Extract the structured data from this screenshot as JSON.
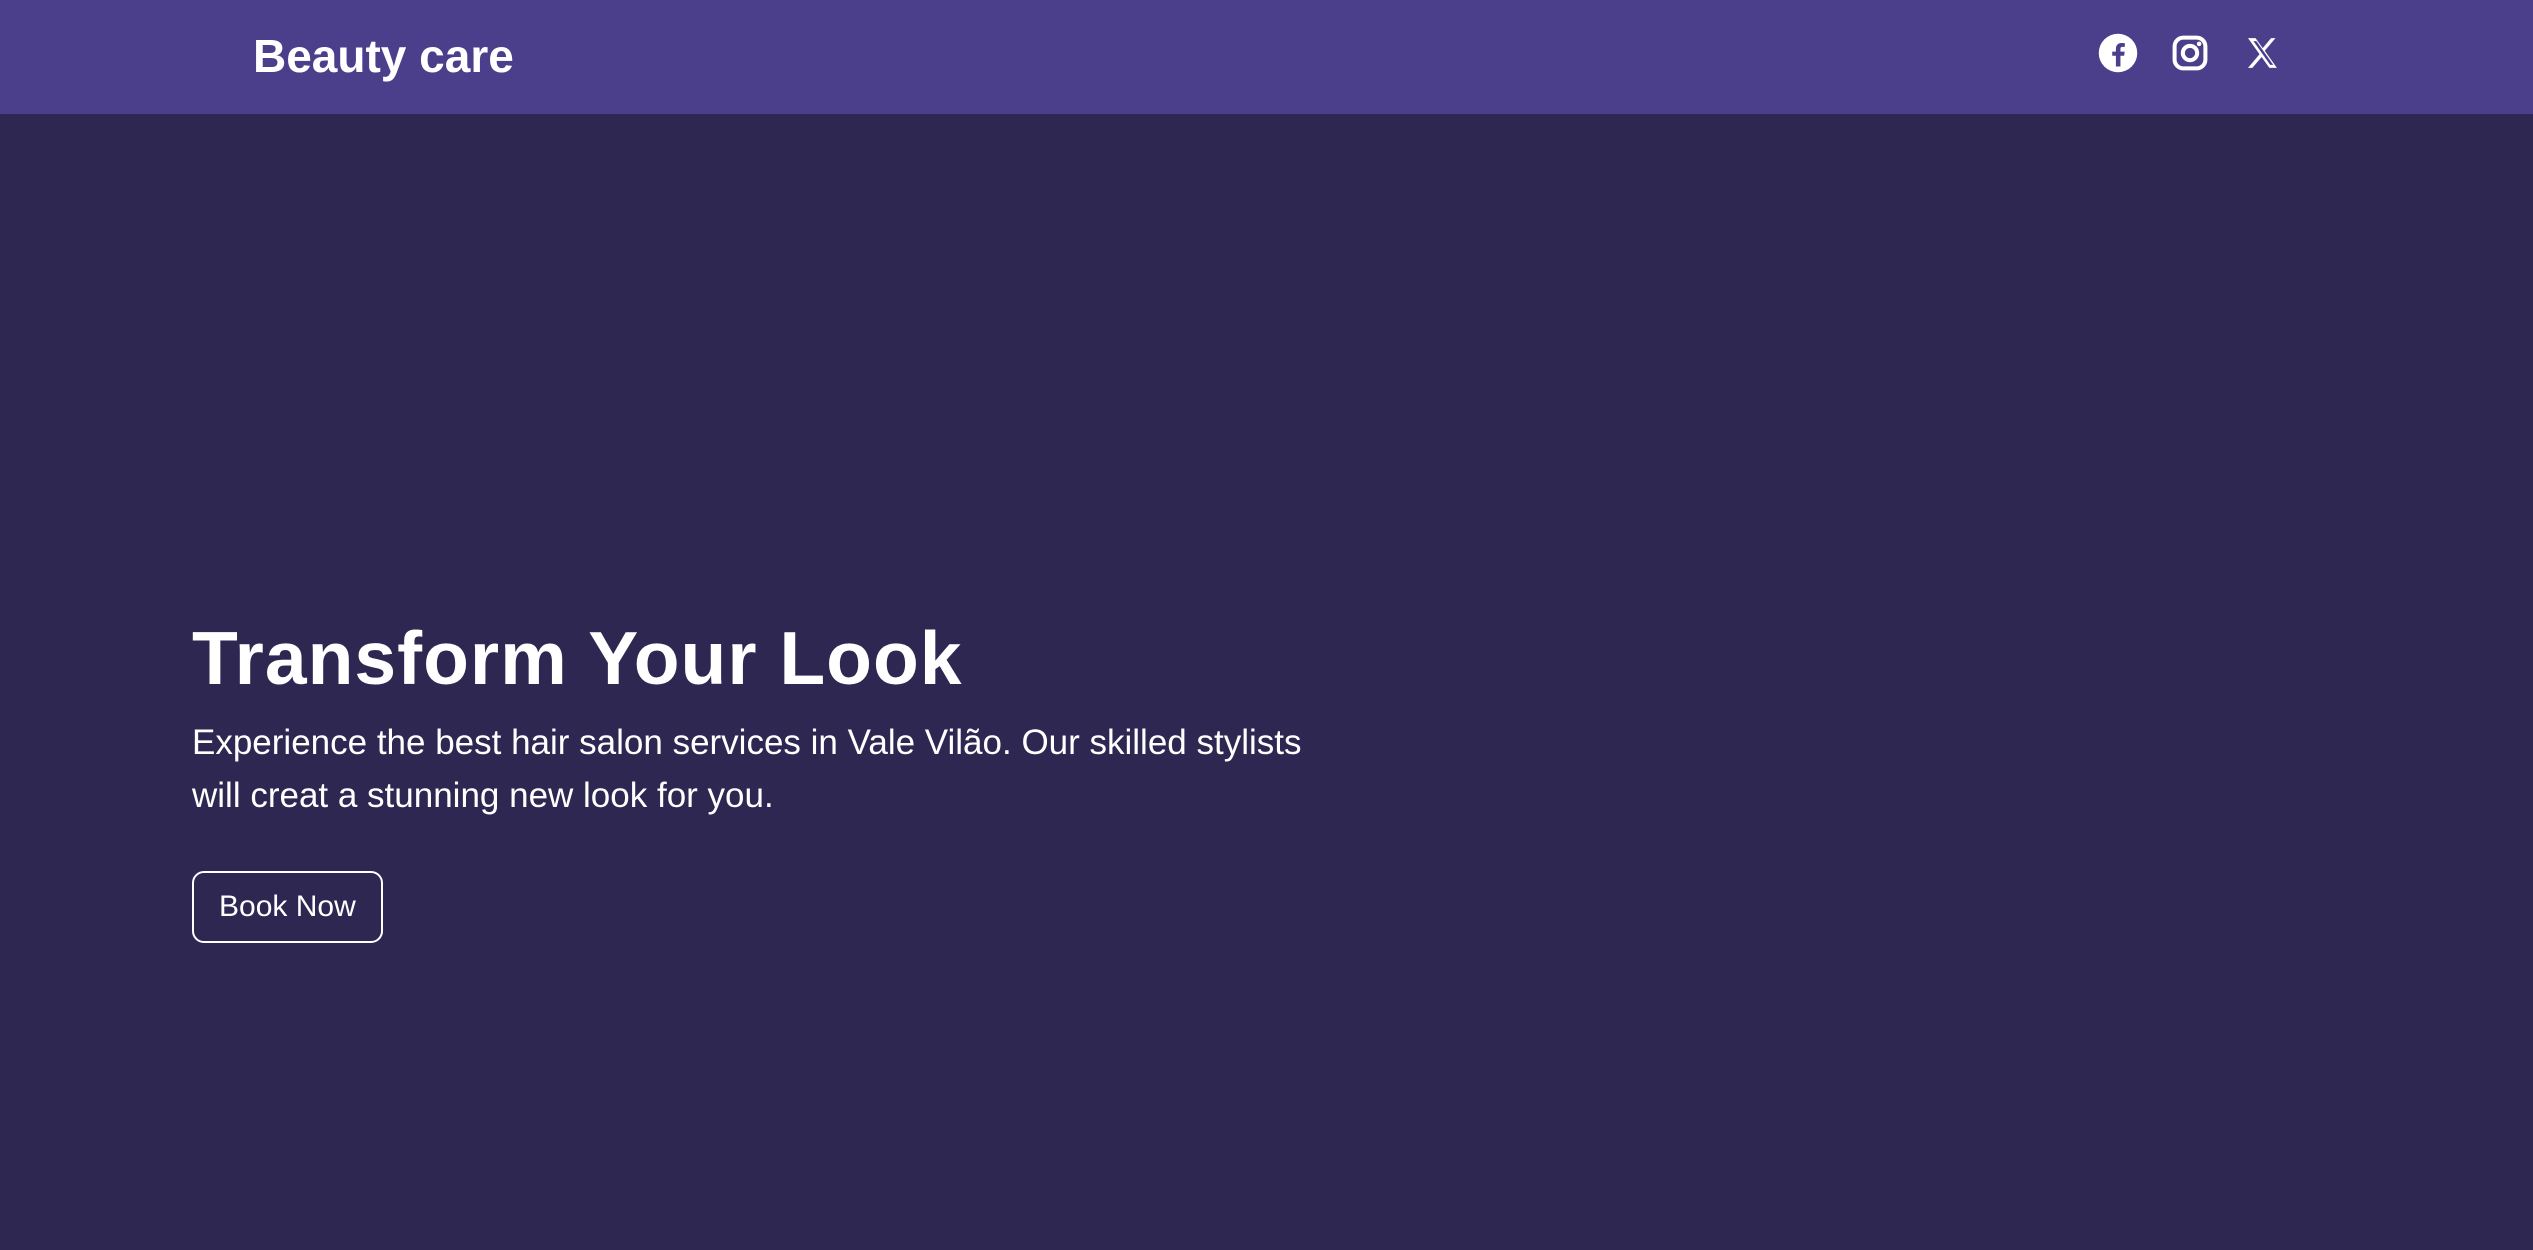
{
  "header": {
    "brand": "Beauty care",
    "social": [
      {
        "name": "facebook-icon"
      },
      {
        "name": "instagram-icon"
      },
      {
        "name": "x-twitter-icon"
      }
    ],
    "colors": {
      "background": "#4b3f8c",
      "text": "#ffffff"
    }
  },
  "hero": {
    "title": "Transform Your Look",
    "text": "Experience the best hair salon services in Vale Vilão. Our skilled stylists will creat a stunning new look for you.",
    "button_label": "Book Now",
    "colors": {
      "background": "#2d2752",
      "text": "#ffffff"
    }
  }
}
